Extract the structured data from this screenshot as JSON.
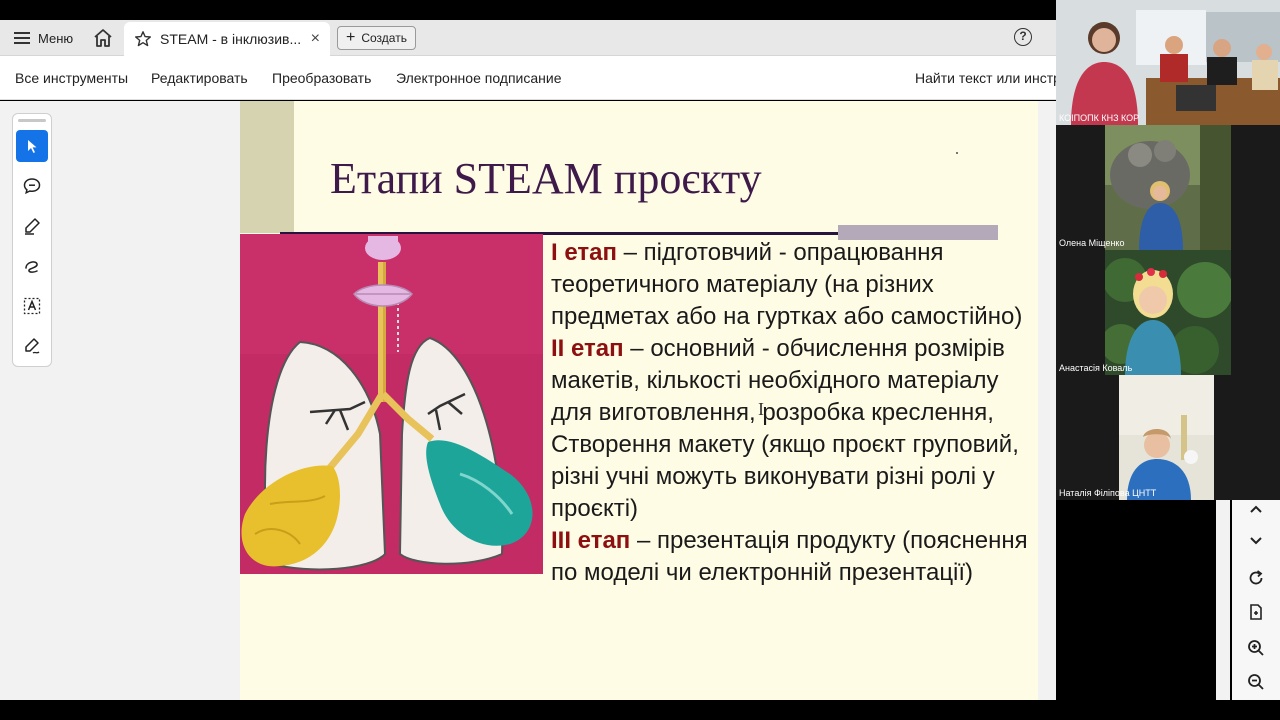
{
  "app": {
    "menu_label": "Меню",
    "tab_title": "STEAM - в інклюзив...",
    "tab_close": "×",
    "create_label": "Создать",
    "create_plus": "+",
    "help_symbol": "?"
  },
  "toolbar": {
    "all_tools": "Все инструменты",
    "edit": "Редактировать",
    "convert": "Преобразовать",
    "e_sign": "Электронное подписание",
    "find": "Найти текст или инструменты"
  },
  "slide": {
    "title": "Етапи STEAM проєкту",
    "stages": [
      {
        "label": "I етап",
        "text": " – підготовчий - опрацювання теоретичного матеріалу (на різних предметах або на гуртках або самостійно)"
      },
      {
        "label": "II етап",
        "text": " – основний - обчислення розмірів макетів, кількості необхідного матеріалу для виготовлення, розробка креслення, Створення макету (якщо проєкт груповий, різні учні можуть виконувати різні ролі у проєкті)"
      },
      {
        "label": "III етап",
        "text": " – презентація продукту (пояснення по моделі чи електронній презентації)"
      }
    ],
    "cursor_glyph": "I"
  },
  "participants": [
    {
      "name": "КОІПОПК КНЗ КОР"
    },
    {
      "name": "Олена Міщенко"
    },
    {
      "name": "Анастасія Коваль"
    },
    {
      "name": "Наталія Філіпова ЦНТТ"
    }
  ],
  "icons": {
    "left_tools": [
      "select-arrow-icon",
      "add-comment-icon",
      "highlight-pen-icon",
      "draw-freehand-icon",
      "text-box-icon",
      "fill-sign-icon"
    ],
    "right_rail": [
      "scroll-up-icon",
      "scroll-down-icon",
      "rotate-icon",
      "extract-page-icon",
      "zoom-in-icon",
      "zoom-out-icon"
    ]
  },
  "colors": {
    "accent": "#1473e6",
    "slide_bg": "#fffce6",
    "slide_title": "#3d1a4a",
    "stage_label": "#8c1010",
    "photo_bg": "#c22b63"
  }
}
